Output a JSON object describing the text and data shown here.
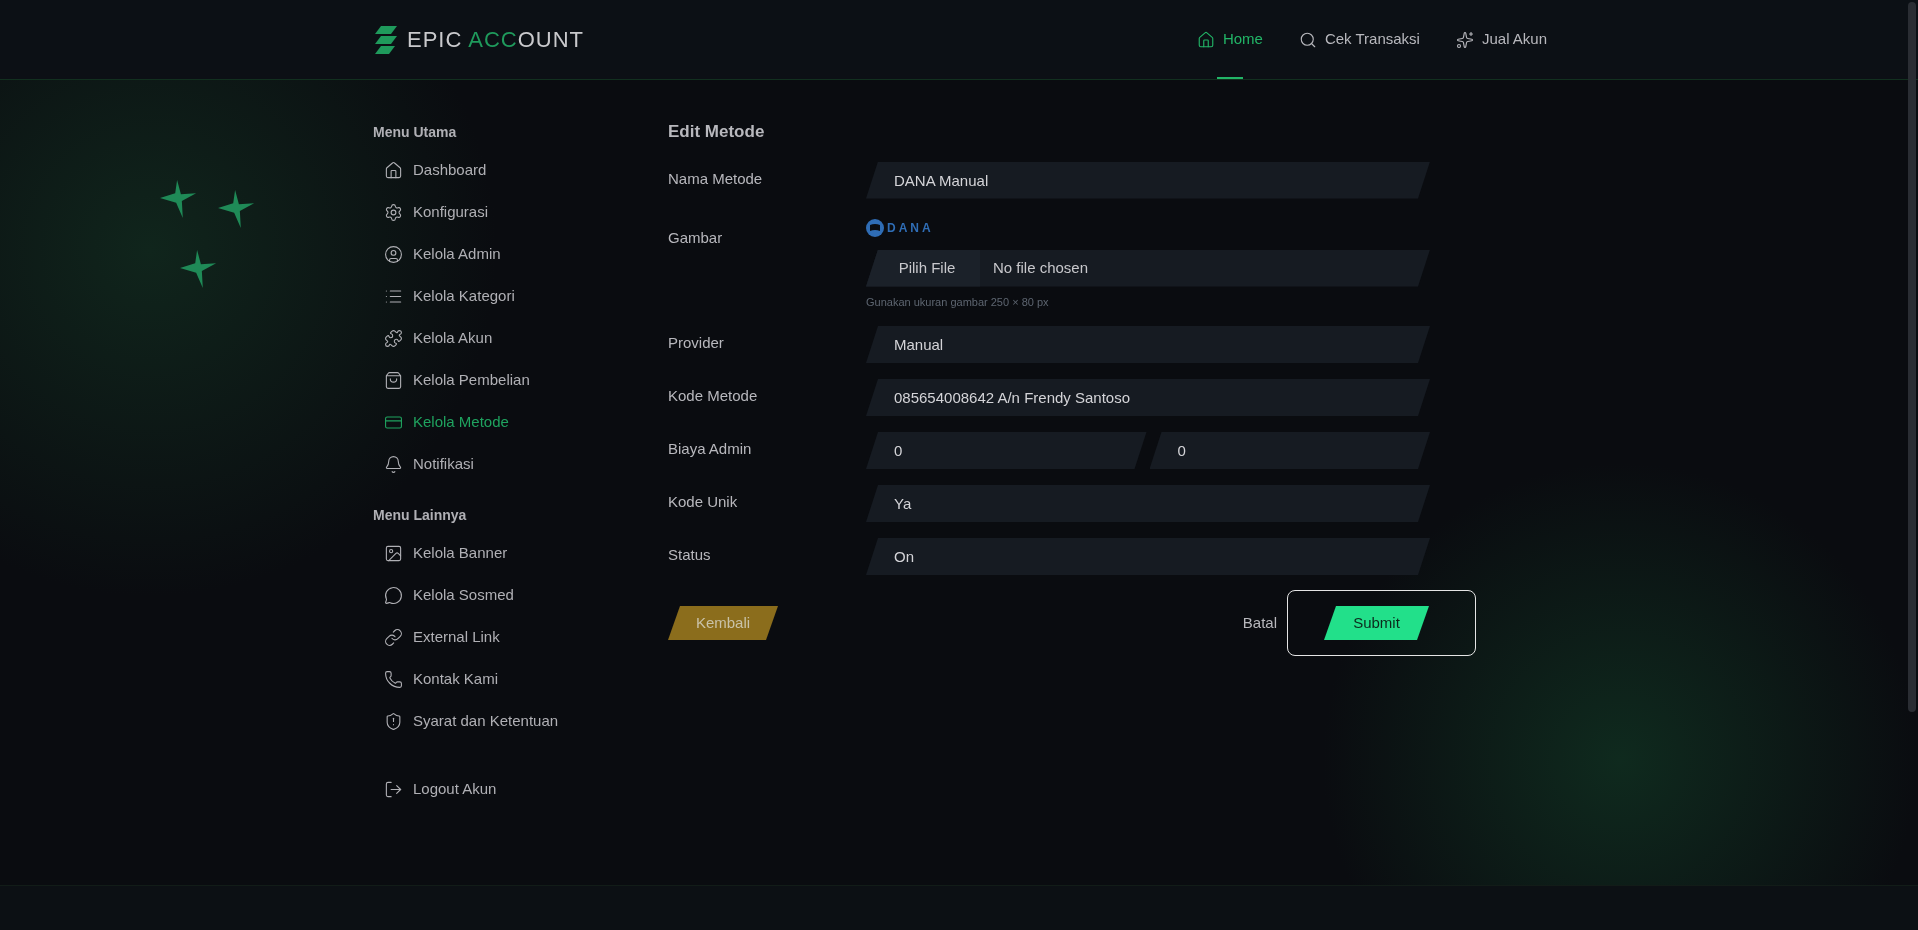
{
  "header": {
    "logo": [
      {
        "text": "EPIC ",
        "accent": false
      },
      {
        "text": "ACC",
        "accent": true
      },
      {
        "text": "OUNT",
        "accent": false
      }
    ],
    "nav": [
      {
        "label": "Home",
        "selected": true
      },
      {
        "label": "Cek Transaksi",
        "selected": false
      },
      {
        "label": "Jual Akun",
        "selected": false
      }
    ]
  },
  "sidebar": {
    "sections": [
      {
        "title": "Menu Utama",
        "items": [
          {
            "label": "Dashboard",
            "selected": false
          },
          {
            "label": "Konfigurasi",
            "selected": false
          },
          {
            "label": "Kelola Admin",
            "selected": false
          },
          {
            "label": "Kelola Kategori",
            "selected": false
          },
          {
            "label": "Kelola Akun",
            "selected": false
          },
          {
            "label": "Kelola Pembelian",
            "selected": false
          },
          {
            "label": "Kelola Metode",
            "selected": true
          },
          {
            "label": "Notifikasi",
            "selected": false
          }
        ]
      },
      {
        "title": "Menu Lainnya",
        "items": [
          {
            "label": "Kelola Banner",
            "selected": false
          },
          {
            "label": "Kelola Sosmed",
            "selected": false
          },
          {
            "label": "External Link",
            "selected": false
          },
          {
            "label": "Kontak Kami",
            "selected": false
          },
          {
            "label": "Syarat dan Ketentuan",
            "selected": false
          }
        ]
      }
    ],
    "logout": "Logout Akun"
  },
  "form": {
    "title": "Edit Metode",
    "fields": [
      {
        "kind": "text",
        "label": "Nama Metode",
        "values": [
          "DANA Manual"
        ]
      },
      {
        "kind": "image",
        "label": "Gambar",
        "logo_text": "DANA",
        "button": "Pilih File",
        "file_status": "No file chosen",
        "hint": "Gunakan ukuran gambar 250 × 80 px"
      },
      {
        "kind": "text",
        "label": "Provider",
        "values": [
          "Manual"
        ]
      },
      {
        "kind": "text",
        "label": "Kode Metode",
        "values": [
          "085654008642 A/n Frendy Santoso"
        ]
      },
      {
        "kind": "text",
        "label": "Biaya Admin",
        "values": [
          "0",
          "0"
        ]
      },
      {
        "kind": "text",
        "label": "Kode Unik",
        "values": [
          "Ya"
        ]
      },
      {
        "kind": "text",
        "label": "Status",
        "values": [
          "On"
        ]
      }
    ],
    "back": "Kembali",
    "cancel": "Batal",
    "submit": "Submit"
  }
}
